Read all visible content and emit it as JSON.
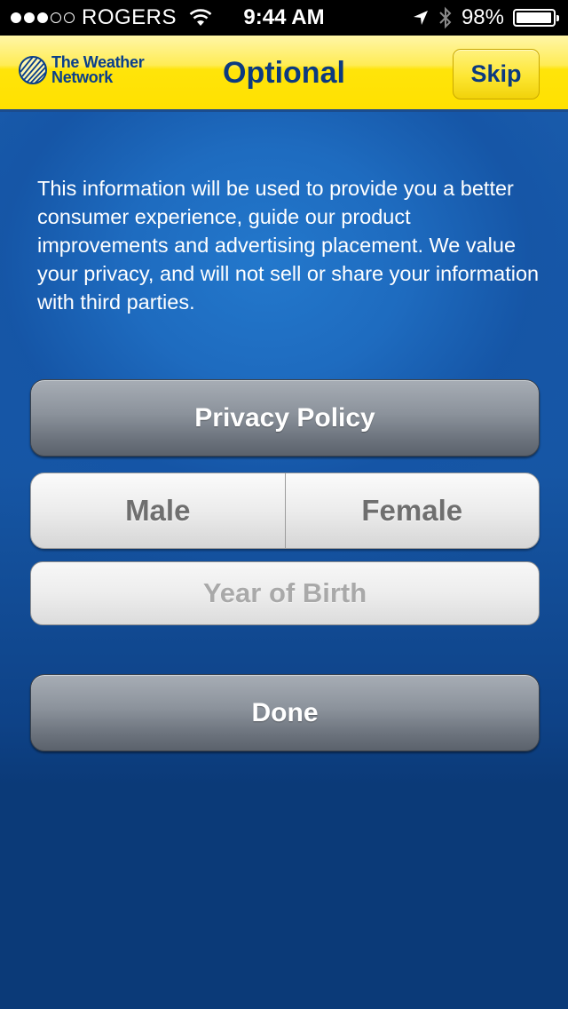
{
  "status_bar": {
    "signal_bars_filled": 3,
    "signal_bars_total": 5,
    "carrier": "ROGERS",
    "time": "9:44 AM",
    "battery_percent_label": "98%",
    "battery_level": 0.98,
    "icons": [
      "wifi-icon",
      "location-arrow-icon",
      "bluetooth-icon",
      "battery-icon"
    ]
  },
  "header": {
    "logo_line1": "The Weather",
    "logo_line2": "Network",
    "title": "Optional",
    "skip_label": "Skip"
  },
  "main": {
    "intro_text": "This information will be used to provide you a better consumer experience, guide our product improvements and advertising placement. We value your privacy, and will not sell or share your information with third parties.",
    "privacy_policy_label": "Privacy Policy",
    "gender_options": [
      "Male",
      "Female"
    ],
    "year_of_birth_placeholder": "Year of Birth",
    "done_label": "Done"
  },
  "colors": {
    "header_yellow": "#ffe100",
    "brand_blue": "#0c3a80",
    "background_blue": "#0b3a78",
    "button_gray": "#8b929b"
  }
}
